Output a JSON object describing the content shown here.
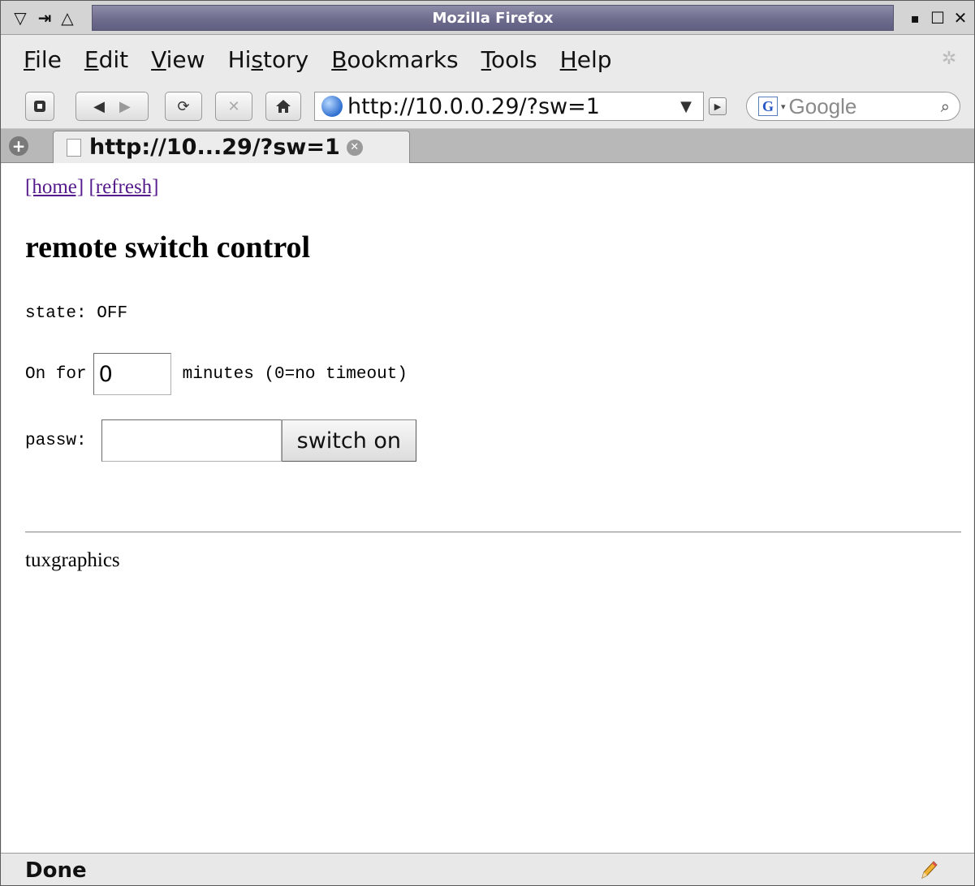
{
  "window": {
    "title": "Mozilla Firefox",
    "left_controls": [
      "▽",
      "⇥",
      "△"
    ],
    "right_controls": [
      "▪",
      "☐",
      "✕"
    ]
  },
  "menubar": {
    "items": [
      {
        "label": "File",
        "accel": "F"
      },
      {
        "label": "Edit",
        "accel": "E"
      },
      {
        "label": "View",
        "accel": "V"
      },
      {
        "label": "History",
        "accel": "s"
      },
      {
        "label": "Bookmarks",
        "accel": "B"
      },
      {
        "label": "Tools",
        "accel": "T"
      },
      {
        "label": "Help",
        "accel": "H"
      }
    ]
  },
  "navbar": {
    "url": "http://10.0.0.29/?sw=1",
    "search_engine": "G",
    "search_placeholder": "Google",
    "icons": [
      "bookmark-icon",
      "back-icon",
      "forward-icon",
      "reload-icon",
      "stop-icon",
      "home-icon"
    ]
  },
  "tabbar": {
    "tab_label": "http://10...29/?sw=1"
  },
  "content": {
    "links": [
      "[home]",
      "[refresh]"
    ],
    "heading": "remote switch control",
    "state_label": "state:",
    "state_value": "OFF",
    "onfor_label": "On for",
    "minutes_value": "0",
    "minutes_label": "minutes (0=no timeout)",
    "passw_label": "passw:",
    "passw_value": "",
    "switch_button": "switch on",
    "footer": "tuxgraphics"
  },
  "statusbar": {
    "text": "Done"
  }
}
